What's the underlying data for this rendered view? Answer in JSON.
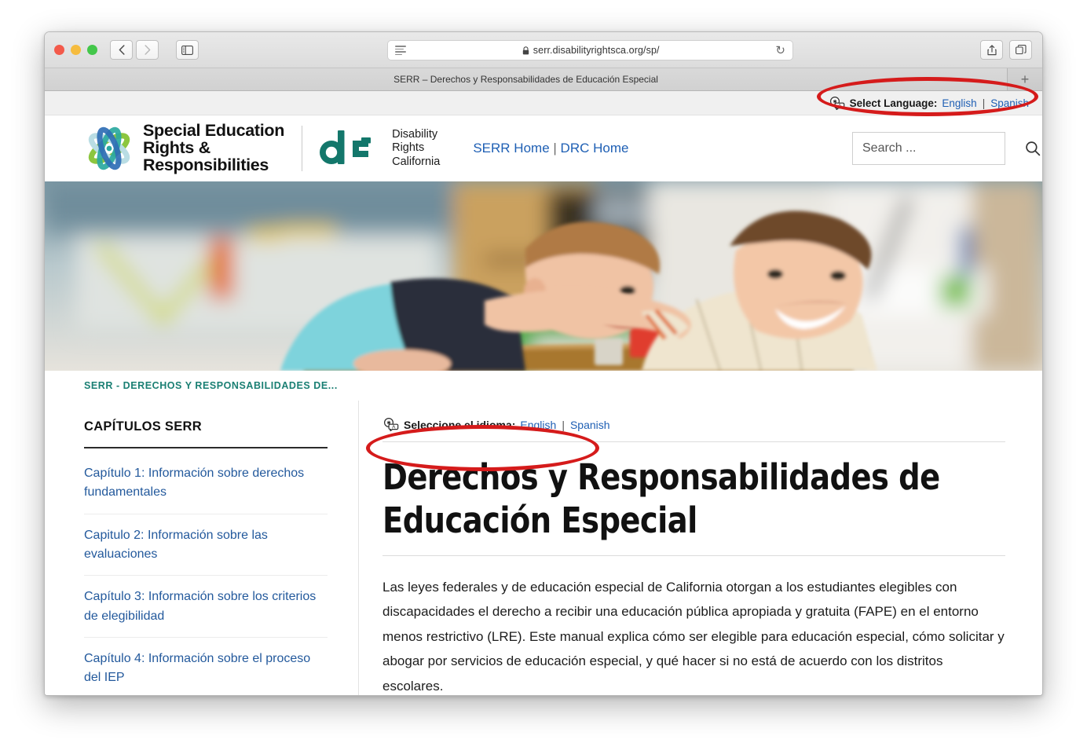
{
  "browser": {
    "url": "serr.disabilityrightsca.org/sp/",
    "lock_icon": "lock-icon",
    "reader_icon": "reader-view-icon",
    "reload_icon": "reload-icon",
    "back_icon": "back-chevron-icon",
    "forward_icon": "forward-chevron-icon",
    "sidebar_icon": "sidebar-toggle-icon",
    "share_icon": "share-icon",
    "tabs_icon": "tab-overview-icon",
    "newtab_label": "+",
    "tab_title": "SERR – Derechos y Responsabilidades de Educación Especial"
  },
  "topbar": {
    "translate_icon": "translate-icon",
    "label": "Select Language:",
    "english": "English",
    "separator": "|",
    "spanish": "Spanish"
  },
  "header": {
    "serr_logo_line1": "Special Education",
    "serr_logo_line2": "Rights &",
    "serr_logo_line3": "Responsibilities",
    "drc_logo_line1": "Disability",
    "drc_logo_line2": "Rights",
    "drc_logo_line3": "California",
    "nav_serr_home": "SERR Home",
    "nav_separator": "|",
    "nav_drc_home": "DRC Home",
    "search_placeholder": "Search ...",
    "search_value": "",
    "search_icon": "search-icon"
  },
  "hero": {
    "alt": "Two smiling children in a classroom with colored building blocks"
  },
  "breadcrumb": {
    "text": "SERR - DERECHOS Y RESPONSABILIDADES DE..."
  },
  "sidebar": {
    "title": "CAPÍTULOS SERR",
    "items": [
      {
        "label": "Capítulo 1: Información sobre derechos fundamentales"
      },
      {
        "label": "Capitulo 2: Información sobre las evaluaciones"
      },
      {
        "label": "Capítulo 3: Información sobre los criterios de elegibilidad"
      },
      {
        "label": "Capítulo 4: Información sobre el proceso del IEP"
      }
    ]
  },
  "main": {
    "translate_icon": "translate-icon",
    "lang_label": "Seleccione el idioma:",
    "lang_english": "English",
    "lang_separator": "|",
    "lang_spanish": "Spanish",
    "title": "Derechos y Responsabilidades de Educación Especial",
    "paragraph": "Las leyes federales y de educación especial de California otorgan a los estudiantes elegibles con discapacidades el derecho a recibir una educación pública apropiada y gratuita (FAPE) en el entorno menos restrictivo (LRE). Este manual explica cómo ser elegible para educación especial, cómo solicitar y abogar por servicios de educación especial, y qué hacer si no está de acuerdo con los distritos escolares."
  },
  "annotations": {
    "color": "#d51b1b",
    "items": [
      {
        "name": "highlight-select-language"
      },
      {
        "name": "highlight-seleccione-idioma"
      }
    ]
  },
  "colors": {
    "link_blue": "#23599c",
    "teal": "#1a7f73",
    "annotation_red": "#d51b1b"
  }
}
